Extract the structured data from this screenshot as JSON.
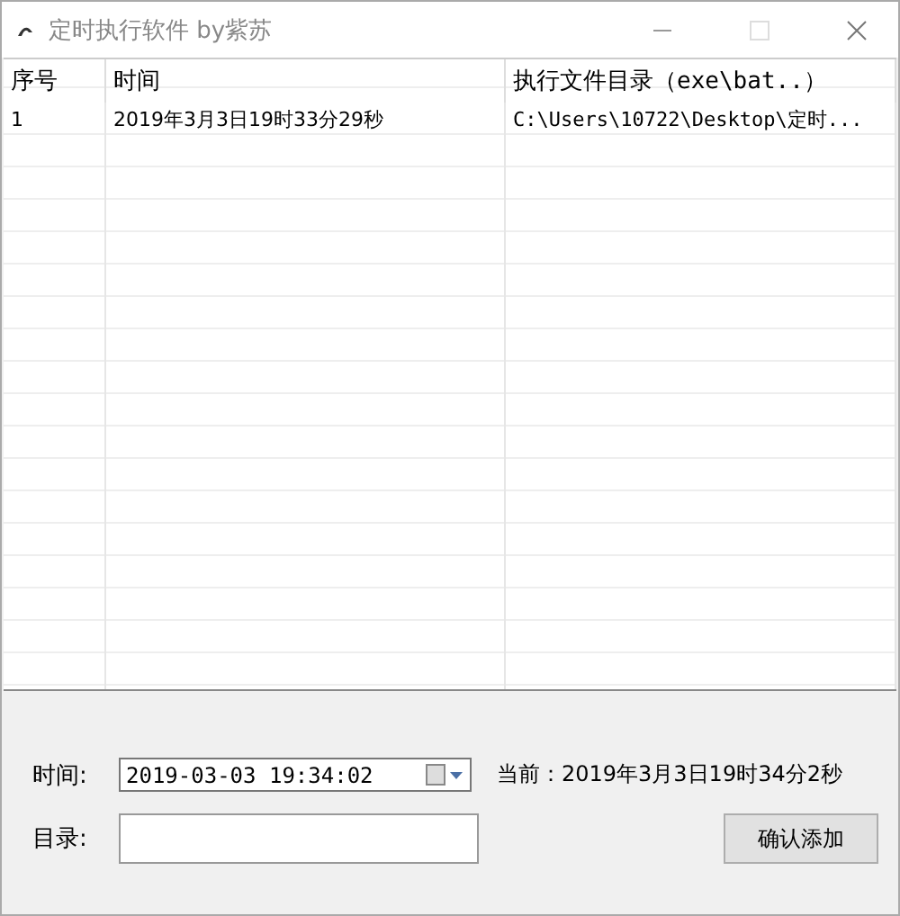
{
  "window": {
    "title": "定时执行软件 by紫苏"
  },
  "table": {
    "columns": [
      "序号",
      "时间",
      "执行文件目录（exe\\bat..）"
    ],
    "rows": [
      [
        "1",
        "2019年3月3日19时33分29秒",
        "C:\\Users\\10722\\Desktop\\定时..."
      ]
    ]
  },
  "form": {
    "time_label": "时间:",
    "time_value": "2019-03-03 19:34:02",
    "current": "当前：2019年3月3日19时34分2秒",
    "dir_label": "目录:",
    "button": "确认添加"
  }
}
